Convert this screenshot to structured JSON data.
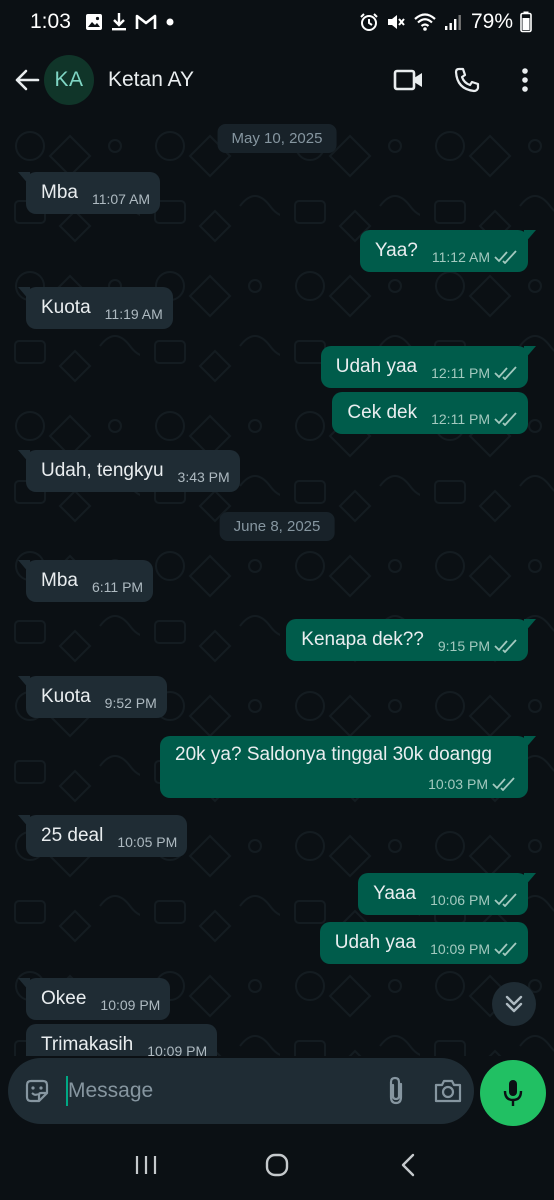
{
  "status_bar": {
    "time": "1:03",
    "battery": "79%",
    "left_icons": [
      "gallery-icon",
      "download-icon",
      "gmail-icon",
      "dot-icon"
    ],
    "right_icons": [
      "alarm-icon",
      "mute-icon",
      "wifi-icon",
      "signal-icon",
      "battery-icon"
    ]
  },
  "header": {
    "avatar_initials": "KA",
    "contact_name": "Ketan AY",
    "actions": [
      "video-call-icon",
      "voice-call-icon",
      "more-options-icon"
    ]
  },
  "chat": {
    "date_1": "May 10, 2025",
    "date_2": "June 8, 2025",
    "messages": [
      {
        "dir": "in",
        "text": "Mba",
        "time": "11:07 AM"
      },
      {
        "dir": "out",
        "text": "Yaa?",
        "time": "11:12 AM",
        "status": "read"
      },
      {
        "dir": "in",
        "text": "Kuota",
        "time": "11:19 AM"
      },
      {
        "dir": "out",
        "text": "Udah yaa",
        "time": "12:11 PM",
        "status": "read"
      },
      {
        "dir": "out",
        "text": "Cek dek",
        "time": "12:11 PM",
        "status": "read"
      },
      {
        "dir": "in",
        "text": "Udah, tengkyu",
        "time": "3:43 PM"
      },
      {
        "dir": "in",
        "text": "Mba",
        "time": "6:11 PM"
      },
      {
        "dir": "out",
        "text": "Kenapa dek??",
        "time": "9:15 PM",
        "status": "read"
      },
      {
        "dir": "in",
        "text": "Kuota",
        "time": "9:52 PM"
      },
      {
        "dir": "out",
        "text": "20k ya? Saldonya tinggal 30k doangg",
        "time": "10:03 PM",
        "status": "read"
      },
      {
        "dir": "in",
        "text": "25 deal",
        "time": "10:05 PM"
      },
      {
        "dir": "out",
        "text": "Yaaa",
        "time": "10:06 PM",
        "status": "read"
      },
      {
        "dir": "out",
        "text": "Udah yaa",
        "time": "10:09 PM",
        "status": "read"
      },
      {
        "dir": "in",
        "text": "Okee",
        "time": "10:09 PM"
      },
      {
        "dir": "in",
        "text": "Trimakasih",
        "time": "10:09 PM"
      }
    ]
  },
  "input": {
    "placeholder": "Message"
  },
  "colors": {
    "background": "#0b1014",
    "incoming_bubble": "#1f2c34",
    "outgoing_bubble": "#005c4b",
    "accent_green": "#21c063",
    "read_tick": "#a3c9bf"
  }
}
